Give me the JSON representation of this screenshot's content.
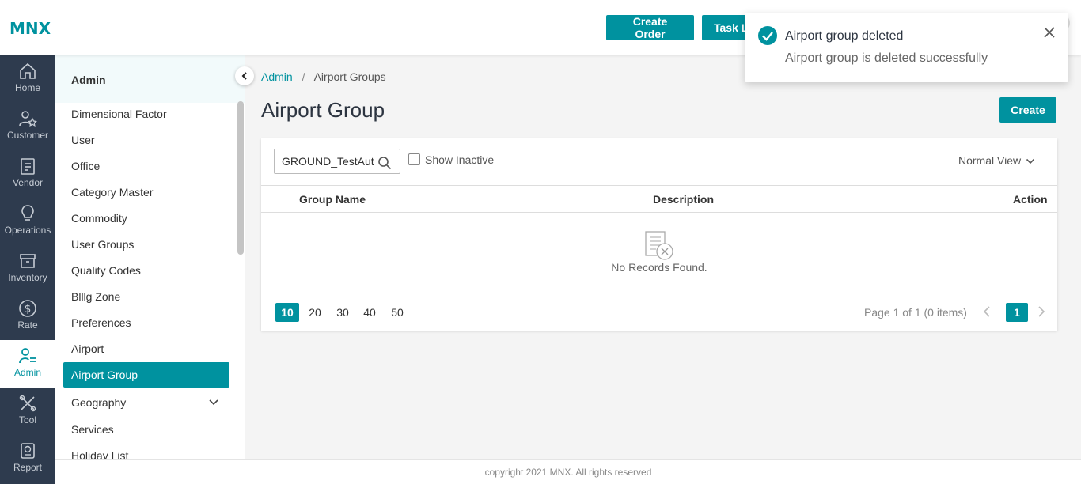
{
  "header": {
    "logo": "MNX",
    "create_order_label": "Create Order",
    "task_label": "Task L"
  },
  "leftnav": [
    {
      "label": "Home",
      "icon": "home-icon"
    },
    {
      "label": "Customer",
      "icon": "customer-icon"
    },
    {
      "label": "Vendor",
      "icon": "vendor-icon"
    },
    {
      "label": "Operations",
      "icon": "lightbulb-icon"
    },
    {
      "label": "Inventory",
      "icon": "inventory-icon"
    },
    {
      "label": "Rate",
      "icon": "dollar-icon"
    },
    {
      "label": "Admin",
      "icon": "admin-icon",
      "active": true
    },
    {
      "label": "Tool",
      "icon": "tools-icon"
    },
    {
      "label": "Report",
      "icon": "report-icon"
    }
  ],
  "sidebar": {
    "title": "Admin",
    "items": [
      {
        "label": "Dimensional Factor"
      },
      {
        "label": "User"
      },
      {
        "label": "Office"
      },
      {
        "label": "Category Master"
      },
      {
        "label": "Commodity"
      },
      {
        "label": "User Groups"
      },
      {
        "label": "Quality Codes"
      },
      {
        "label": "Blllg Zone"
      },
      {
        "label": "Preferences"
      },
      {
        "label": "Airport"
      },
      {
        "label": "Airport Group",
        "active": true
      },
      {
        "label": "Geography",
        "expandable": true
      },
      {
        "label": "Services"
      },
      {
        "label": "Holiday List"
      }
    ]
  },
  "breadcrumb": {
    "root": "Admin",
    "separator": "/",
    "current": "Airport Groups"
  },
  "page": {
    "title": "Airport Group",
    "create_label": "Create"
  },
  "filters": {
    "search_value": "GROUND_TestAutomation",
    "show_inactive_label": "Show Inactive",
    "show_inactive_checked": false,
    "view_label": "Normal View"
  },
  "table": {
    "columns": [
      "Group Name",
      "Description",
      "Action"
    ],
    "rows": [],
    "empty_message": "No Records Found."
  },
  "pagination": {
    "page_sizes": [
      "10",
      "20",
      "30",
      "40",
      "50"
    ],
    "selected_size": "10",
    "info": "Page 1 of 1 (0 items)",
    "current_page": "1"
  },
  "toast": {
    "title": "Airport group deleted",
    "message": "Airport group is deleted successfully",
    "status_color": "#00929f"
  },
  "footer": {
    "text": "copyright 2021 MNX. All rights reserved"
  },
  "colors": {
    "accent": "#00929f",
    "nav_bg": "#2e3b4e"
  }
}
